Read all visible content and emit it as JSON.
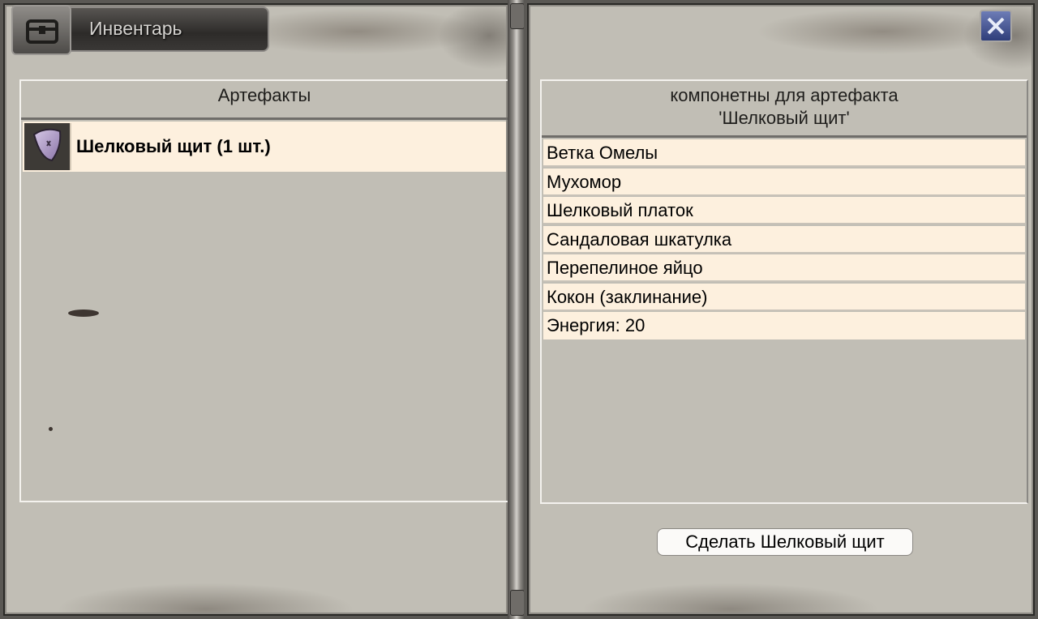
{
  "window": {
    "title": "Инвентарь"
  },
  "left_panel": {
    "header": "Артефакты",
    "items": [
      {
        "label": "Шелковый щит (1 шт.)",
        "icon": "shield-icon"
      }
    ]
  },
  "right_panel": {
    "header_line1": "компонетны для артефакта",
    "header_line2": "'Шелковый щит'",
    "components": [
      "Ветка Омелы",
      "Мухомор",
      "Шелковый платок",
      "Сандаловая шкатулка",
      "Перепелиное яйцо",
      "Кокон (заклинание)",
      "Энергия: 20"
    ],
    "make_button": "Сделать Шелковый щит"
  },
  "colors": {
    "row_bg": "#fdf0de",
    "panel_bg": "#c1beb5",
    "close_button": "#3b4a8c"
  }
}
